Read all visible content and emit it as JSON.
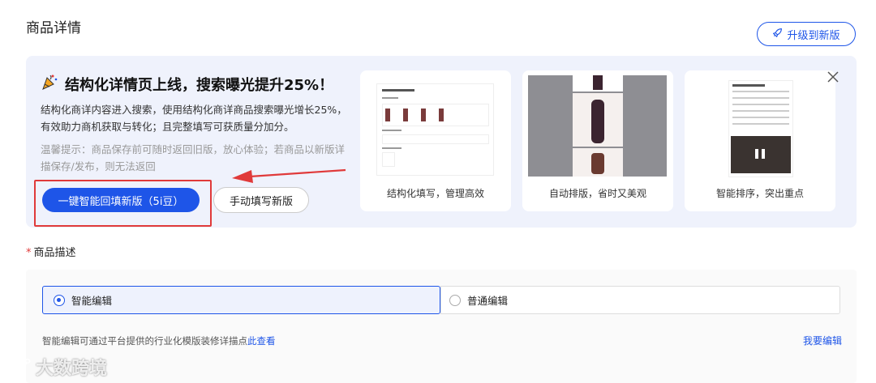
{
  "page": {
    "title": "商品详情"
  },
  "upgrade_button": {
    "label": "升级到新版",
    "icon": "rocket-icon"
  },
  "banner": {
    "headline": "结构化详情页上线，搜索曝光提升25%！",
    "headline_icon": "party-popper-icon",
    "description": "结构化商详内容进入搜索，使用结构化商详商品搜索曝光增长25%，有效助力商机获取与转化；且完整填写可获质量分加分。",
    "tip": "温馨提示：商品保存前可随时返回旧版，放心体验；若商品以新版详描保存/发布，则无法返回",
    "primary_button": "一键智能回填新版（5i豆）",
    "secondary_button": "手动填写新版",
    "cards": [
      {
        "label": "结构化填写，管理高效"
      },
      {
        "label": "自动排版，省时又美观"
      },
      {
        "label": "智能排序，突出重点"
      }
    ]
  },
  "section": {
    "label": "商品描述",
    "required_mark": "*"
  },
  "editor": {
    "options": [
      {
        "label": "智能编辑",
        "selected": true
      },
      {
        "label": "普通编辑",
        "selected": false
      }
    ],
    "hint_text": "智能编辑可通过平台提供的行业化模版装修详描点",
    "hint_link": "此查看",
    "want_edit": "我要编辑"
  },
  "watermark": {
    "text": "大数跨境"
  },
  "colors": {
    "accent": "#1e55e8",
    "banner_bg": "#eff2fc",
    "highlight": "#e03a3a"
  }
}
